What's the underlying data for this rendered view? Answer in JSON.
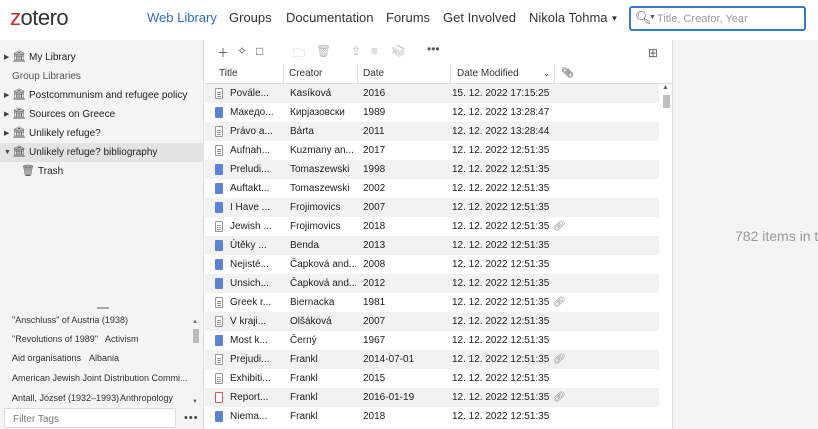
{
  "header": {
    "logo": "zotero",
    "nav": {
      "web_library": "Web Library",
      "groups": "Groups",
      "documentation": "Documentation",
      "forums": "Forums",
      "get_involved": "Get Involved",
      "user": "Nikola Tohma"
    },
    "search_placeholder": "Title, Creator, Year",
    "accent_color": "#2e6ec4"
  },
  "sidebar": {
    "my_library": "My Library",
    "group_libraries": "Group Libraries",
    "collections": [
      "Postcommunism and refugee policy",
      "Sources on Greece",
      "Unlikely refuge?",
      "Unlikely refuge? bibliography"
    ],
    "trash": "Trash",
    "tags": [
      "\"Anschluss\" of Austria (1938)",
      "\"Revolutions of 1989\"",
      "Activism",
      "Aid organisations",
      "Albania",
      "American Jewish Joint Distribution Commi...",
      "Antall, József (1932–1993)",
      "Anthropology"
    ],
    "filter_tags_placeholder": "Filter Tags"
  },
  "items": {
    "columns": {
      "title": "Title",
      "creator": "Creator",
      "date": "Date",
      "date_modified": "Date Modified"
    },
    "rows": [
      {
        "type": "article",
        "title": "Povále...",
        "creator": "Kasíková",
        "date": "2016",
        "modified": "15. 12. 2022 17:15:25",
        "attach": false
      },
      {
        "type": "book",
        "title": "Македо...",
        "creator": "Кирјазовски",
        "date": "1989",
        "modified": "12. 12. 2022 13:28:47",
        "attach": false
      },
      {
        "type": "article",
        "title": "Právo a...",
        "creator": "Bárta",
        "date": "2011",
        "modified": "12. 12. 2022 13:28:44",
        "attach": false
      },
      {
        "type": "article",
        "title": "Aufnah...",
        "creator": "Kuzmany an...",
        "date": "2017",
        "modified": "12. 12. 2022 12:51:35",
        "attach": false
      },
      {
        "type": "book",
        "title": "Preludi...",
        "creator": "Tomaszewski",
        "date": "1998",
        "modified": "12. 12. 2022 12:51:35",
        "attach": false
      },
      {
        "type": "book",
        "title": "Auftakt...",
        "creator": "Tomaszewski",
        "date": "2002",
        "modified": "12. 12. 2022 12:51:35",
        "attach": false
      },
      {
        "type": "book",
        "title": "I Have ...",
        "creator": "Frojimovics",
        "date": "2007",
        "modified": "12. 12. 2022 12:51:35",
        "attach": false
      },
      {
        "type": "article",
        "title": "Jewish ...",
        "creator": "Frojimovics",
        "date": "2018",
        "modified": "12. 12. 2022 12:51:35",
        "attach": true
      },
      {
        "type": "book",
        "title": "Útěky ...",
        "creator": "Benda",
        "date": "2013",
        "modified": "12. 12. 2022 12:51:35",
        "attach": false
      },
      {
        "type": "book",
        "title": "Nejisté...",
        "creator": "Čapková and...",
        "date": "2008",
        "modified": "12. 12. 2022 12:51:35",
        "attach": false
      },
      {
        "type": "book",
        "title": "Unsich...",
        "creator": "Čapková and...",
        "date": "2012",
        "modified": "12. 12. 2022 12:51:35",
        "attach": false
      },
      {
        "type": "article",
        "title": "Greek r...",
        "creator": "Biernacka",
        "date": "1981",
        "modified": "12. 12. 2022 12:51:35",
        "attach": true
      },
      {
        "type": "article",
        "title": "V kraji...",
        "creator": "Olšáková",
        "date": "2007",
        "modified": "12. 12. 2022 12:51:35",
        "attach": false
      },
      {
        "type": "book",
        "title": "Most k...",
        "creator": "Černý",
        "date": "1967",
        "modified": "12. 12. 2022 12:51:35",
        "attach": false
      },
      {
        "type": "article",
        "title": "Prejudi...",
        "creator": "Frankl",
        "date": "2014-07-01",
        "modified": "12. 12. 2022 12:51:35",
        "attach": true
      },
      {
        "type": "article",
        "title": "Exhibiti...",
        "creator": "Frankl",
        "date": "2015",
        "modified": "12. 12. 2022 12:51:35",
        "attach": false
      },
      {
        "type": "report",
        "title": "Report...",
        "creator": "Frankl",
        "date": "2016-01-19",
        "modified": "12. 12. 2022 12:51:35",
        "attach": true
      },
      {
        "type": "book",
        "title": "Niema...",
        "creator": "Frankl",
        "date": "2018",
        "modified": "12. 12. 2022 12:51:35",
        "attach": false
      }
    ]
  },
  "item_pane": {
    "count_text": "782 items in t"
  }
}
